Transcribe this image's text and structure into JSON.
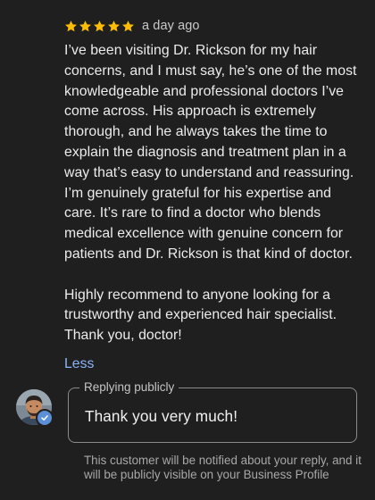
{
  "review": {
    "rating": 5,
    "star_color": "#fbbc04",
    "time": "a day ago",
    "paragraphs": [
      "I’ve been visiting Dr. Rickson for my hair concerns, and I must say, he’s one of the most knowledgeable and professional doctors I’ve come across. His approach is extremely thorough, and he always takes the time to explain the diagnosis and treatment plan in a way that’s easy to understand and reassuring.",
      "I’m genuinely grateful for his expertise and care. It’s rare to find a doctor who blends medical excellence with genuine concern for patients and Dr. Rickson is that kind of doctor.",
      "Highly recommend to anyone looking for a trustworthy and experienced hair specialist. Thank you, doctor!"
    ],
    "less_label": "Less"
  },
  "reply": {
    "legend": "Replying publicly",
    "text": "Thank you very much!",
    "notice": "This customer will be notified about your reply, and it will be publicly visible on your Business Profile"
  },
  "icons": {
    "star": "star-icon",
    "verified": "verified-check-icon",
    "avatar": "owner-avatar"
  },
  "colors": {
    "background": "#1f1f1f",
    "link": "#8ab4f8",
    "verified_badge": "#5b8fd6"
  }
}
